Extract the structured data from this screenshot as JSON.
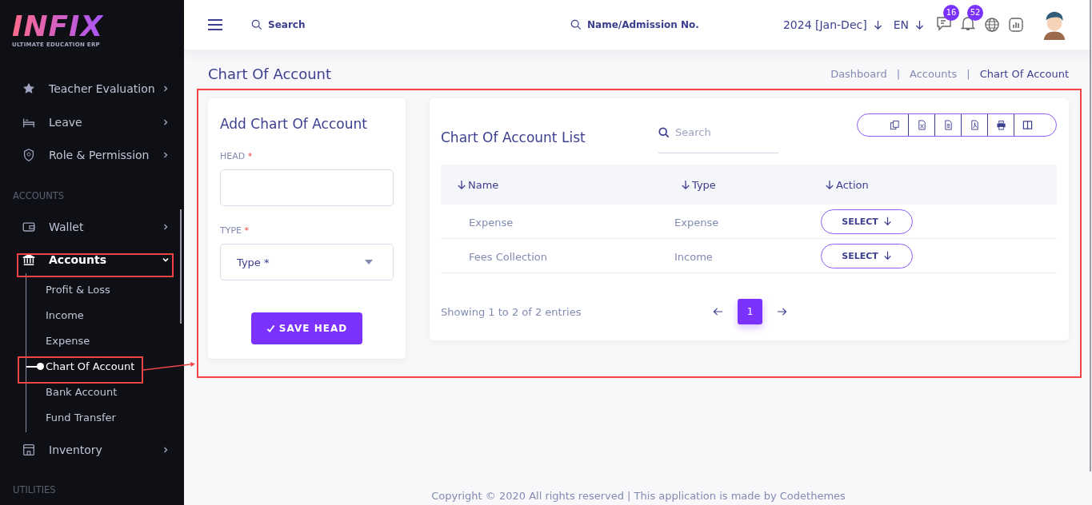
{
  "logo": {
    "name": "INFIX",
    "tagline": "ULTIMATE EDUCATION ERP"
  },
  "sidebar": {
    "items": [
      {
        "kind": "item",
        "label": "Teacher Evaluation",
        "expanded": false,
        "selected": false
      },
      {
        "kind": "item",
        "label": "Leave",
        "expanded": false,
        "selected": false
      },
      {
        "kind": "item",
        "label": "Role & Permission",
        "expanded": false,
        "selected": false
      },
      {
        "kind": "section",
        "label": "ACCOUNTS"
      },
      {
        "kind": "item",
        "label": "Wallet",
        "expanded": false,
        "selected": false
      },
      {
        "kind": "item",
        "label": "Accounts",
        "expanded": true,
        "selected": false,
        "children": [
          {
            "label": "Profit & Loss",
            "selected": false
          },
          {
            "label": "Income",
            "selected": false
          },
          {
            "label": "Expense",
            "selected": false
          },
          {
            "label": "Chart Of Account",
            "selected": true
          },
          {
            "label": "Bank Account",
            "selected": false
          },
          {
            "label": "Fund Transfer",
            "selected": false
          }
        ]
      },
      {
        "kind": "item",
        "label": "Inventory",
        "expanded": false,
        "selected": false
      },
      {
        "kind": "section",
        "label": "UTILITIES"
      }
    ]
  },
  "header": {
    "search_placeholder": "Search",
    "student_search_placeholder": "Name/Admission No.",
    "session": "2024 [Jan-Dec]",
    "language": "EN",
    "message_count": "16",
    "notification_count": "52"
  },
  "page": {
    "title": "Chart Of Account",
    "breadcrumb_separator": "|",
    "breadcrumbs": [
      {
        "label": "Dashboard",
        "selected": false
      },
      {
        "label": "Accounts",
        "selected": false
      },
      {
        "label": "Chart Of Account",
        "selected": true
      }
    ]
  },
  "form": {
    "title": "Add Chart Of Account",
    "fields": [
      {
        "kind": "text",
        "label": "HEAD",
        "required_mark": "*"
      },
      {
        "kind": "select",
        "label": "TYPE",
        "required_mark": "*",
        "placeholder": "Type *"
      }
    ],
    "submit": "SAVE HEAD"
  },
  "list": {
    "title": "Chart Of Account List",
    "search_placeholder": "Search",
    "columns": [
      "Name",
      "Type",
      "Action"
    ],
    "rows": [
      {
        "name": "Expense",
        "type": "Expense",
        "action": "SELECT"
      },
      {
        "name": "Fees Collection",
        "type": "Income",
        "action": "SELECT"
      }
    ],
    "summary": "Showing 1 to 2 of 2 entries",
    "pages": [
      {
        "label": "1",
        "selected": true
      }
    ]
  },
  "footer": "Copyright © 2020 All rights reserved | This application is made by Codethemes"
}
